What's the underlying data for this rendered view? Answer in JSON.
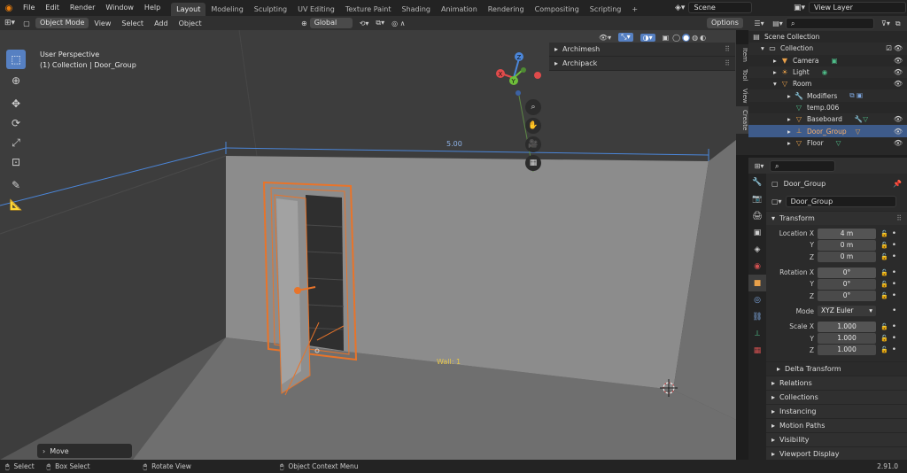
{
  "menus": [
    "File",
    "Edit",
    "Render",
    "Window",
    "Help"
  ],
  "workspaces": [
    "Layout",
    "Modeling",
    "Sculpting",
    "UV Editing",
    "Texture Paint",
    "Shading",
    "Animation",
    "Rendering",
    "Compositing",
    "Scripting"
  ],
  "active_workspace": "Layout",
  "add_workspace": "+",
  "scene": "Scene",
  "view_layer": "View Layer",
  "header": {
    "mode": "Object Mode",
    "items": [
      "View",
      "Select",
      "Add",
      "Object"
    ],
    "transform_orientation": "Global",
    "options": "Options"
  },
  "viewport": {
    "perspective": "User Perspective",
    "collection_info": "(1) Collection | Door_Group",
    "dimension_label": "5.00",
    "wall_label": "Wall: 1",
    "last_op": "Move"
  },
  "npanel": {
    "items": [
      "Archimesh",
      "Archipack"
    ],
    "tabs": [
      "Item",
      "Tool",
      "View",
      "Create"
    ]
  },
  "gizmo": {
    "x": "X",
    "y": "Y",
    "z": "Z"
  },
  "outliner": {
    "rows": [
      {
        "label": "Scene Collection",
        "icon": "scene-collection-icon",
        "indent": 0
      },
      {
        "label": "Collection",
        "icon": "collection-icon",
        "indent": 1
      },
      {
        "label": "Camera",
        "icon": "camera-icon",
        "indent": 2
      },
      {
        "label": "Light",
        "icon": "light-icon",
        "indent": 2
      },
      {
        "label": "Room",
        "icon": "mesh-icon",
        "indent": 2
      },
      {
        "label": "Modifiers",
        "icon": "wrench-icon",
        "indent": 3
      },
      {
        "label": "temp.006",
        "icon": "mesh-data-icon",
        "indent": 3
      },
      {
        "label": "Baseboard",
        "icon": "mesh-icon",
        "indent": 3
      },
      {
        "label": "Door_Group",
        "icon": "empty-icon",
        "indent": 3
      },
      {
        "label": "Floor",
        "icon": "mesh-icon",
        "indent": 3
      }
    ]
  },
  "properties": {
    "object_name": "Door_Group",
    "object_field": "Door_Group",
    "transform_label": "Transform",
    "location_label": "Location X",
    "location": [
      "4 m",
      "0 m",
      "0 m"
    ],
    "rotation_label": "Rotation X",
    "rotation": [
      "0°",
      "0°",
      "0°"
    ],
    "mode_label": "Mode",
    "mode_value": "XYZ Euler",
    "scale_label": "Scale X",
    "scale": [
      "1.000",
      "1.000",
      "1.000"
    ],
    "axis_y": "Y",
    "axis_z": "Z",
    "delta_transform": "Delta Transform",
    "panels": [
      "Relations",
      "Collections",
      "Instancing",
      "Motion Paths",
      "Visibility",
      "Viewport Display"
    ]
  },
  "statusbar": {
    "select": "Select",
    "box_select": "Box Select",
    "rotate_view": "Rotate View",
    "context_menu": "Object Context Menu",
    "version": "2.91.0"
  },
  "colors": {
    "accent": "#5680c2",
    "selection": "#e8742a",
    "measure": "#4b86d9",
    "wall_label": "#e6c64a"
  }
}
